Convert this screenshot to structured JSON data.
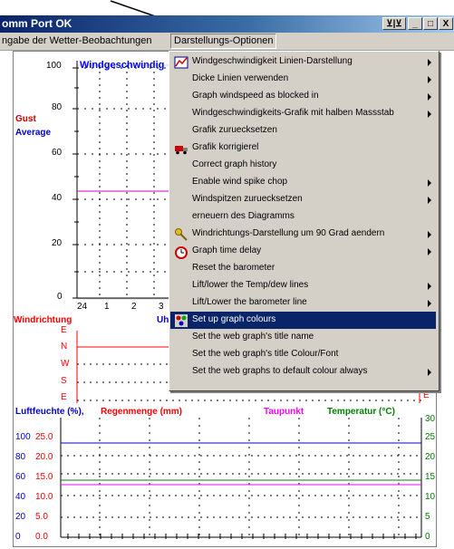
{
  "window": {
    "title": "omm Port OK",
    "controls": [
      "⊻|⊻",
      "_",
      "□",
      "X"
    ]
  },
  "menubar": {
    "items": [
      "ngabe der Wetter-Beobachtungen",
      "Darstellungs-Optionen"
    ]
  },
  "chart": {
    "wind_title": "Windgeschwindig",
    "gust_label": "Gust",
    "average_label": "Average",
    "y_ticks": [
      "100",
      "80",
      "60",
      "40",
      "20",
      "0"
    ],
    "x_ticks": [
      "24",
      "1",
      "2",
      "3"
    ],
    "wind_direction_label": "Windrichtung",
    "time_label": "Uh",
    "directions": [
      "E",
      "N",
      "W",
      "S",
      "E"
    ],
    "direction_right_edge": "E",
    "humidity_label": "Luftfeuchte (%),",
    "rain_label": "Regenmenge (mm)",
    "dew_label": "Taupunkt",
    "temp_label": "Temperatur (°C)",
    "left_ticks": [
      "100",
      "80",
      "60",
      "40",
      "20",
      "0"
    ],
    "rain_ticks": [
      "25.0",
      "20.0",
      "15.0",
      "10.0",
      "5.0",
      "0.0"
    ],
    "right_ticks": [
      "30",
      "25",
      "20",
      "15",
      "10",
      "5",
      "0"
    ],
    "colors": {
      "wind": "#0000ff",
      "gust": "#cc0000",
      "direction": "#ff0000",
      "rain": "#ff0000",
      "dew": "#ff00ff",
      "temp": "#008000"
    }
  },
  "dropdown": {
    "items": [
      {
        "label": "Windgeschwindigkeit Linien-Darstellung",
        "submenu": true,
        "icon": "chart-icon"
      },
      {
        "label": "Dicke Linien verwenden",
        "submenu": true
      },
      {
        "label": "Graph windspeed as blocked in",
        "submenu": true
      },
      {
        "label": "Windgeschwindigkeits-Grafik mit halben Massstab",
        "submenu": true
      },
      {
        "label": "Grafik zuruecksetzen",
        "submenu": false
      },
      {
        "label": "Grafik korrigierel",
        "submenu": false,
        "icon": "truck-icon"
      },
      {
        "label": "Correct graph history",
        "submenu": false
      },
      {
        "label": "Enable wind spike chop",
        "submenu": true
      },
      {
        "label": "Windspitzen zuruecksetzen",
        "submenu": true
      },
      {
        "label": "erneuern des Diagramms",
        "submenu": false
      },
      {
        "label": "Windrichtungs-Darstellung um 90 Grad aendern",
        "submenu": true,
        "icon": "key-icon"
      },
      {
        "label": "Graph time delay",
        "submenu": true,
        "icon": "clock-icon"
      },
      {
        "label": "Reset the barometer",
        "submenu": false
      },
      {
        "label": "Lift/lower the Temp/dew lines",
        "submenu": true
      },
      {
        "label": "Lift/Lower the barometer line",
        "submenu": true
      },
      {
        "label": "Set up graph colours",
        "submenu": false,
        "icon": "palette-icon",
        "highlighted": true
      },
      {
        "label": "Set the web graph's title name",
        "submenu": false
      },
      {
        "label": "Set the web graph's title Colour/Font",
        "submenu": false
      },
      {
        "label": "Set the web graphs to default colour always",
        "submenu": true
      }
    ]
  }
}
